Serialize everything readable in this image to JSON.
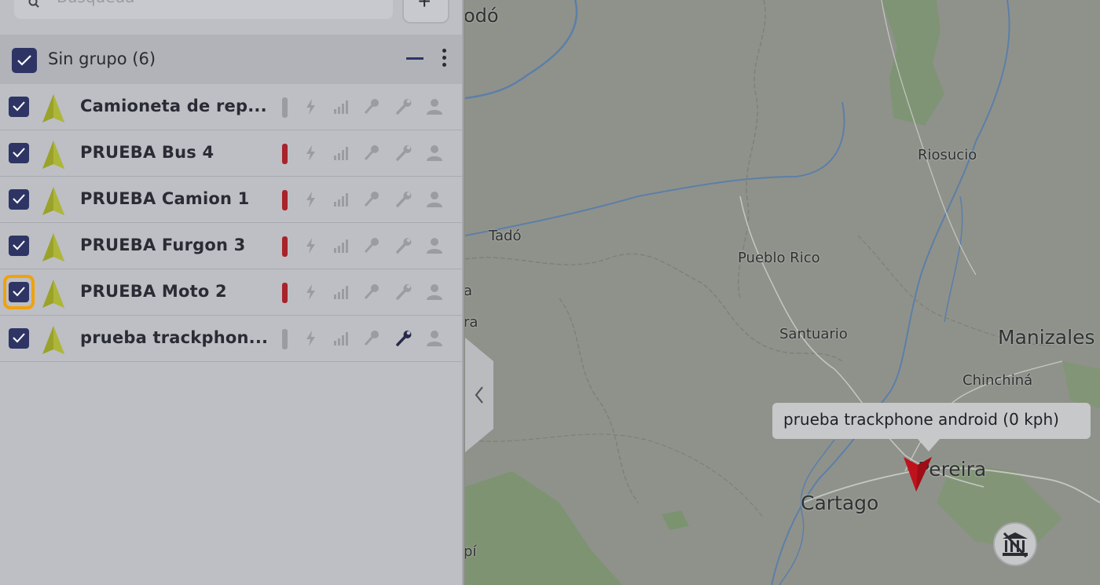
{
  "sidebar": {
    "search": {
      "placeholder": "Búsqueda"
    },
    "add_label": "+",
    "group": {
      "label": "Sin grupo (6)"
    },
    "vehicles": [
      {
        "name": "Camioneta de rep...",
        "status_color": "#9a9ca1",
        "wrench_active": false
      },
      {
        "name": "PRUEBA Bus 4",
        "status_color": "#a8232b",
        "wrench_active": false
      },
      {
        "name": "PRUEBA Camion 1",
        "status_color": "#a8232b",
        "wrench_active": false
      },
      {
        "name": "PRUEBA Furgon 3",
        "status_color": "#a8232b",
        "wrench_active": false
      },
      {
        "name": "PRUEBA Moto 2",
        "status_color": "#a8232b",
        "wrench_active": false
      },
      {
        "name": "prueba trackphon...",
        "status_color": "#9a9ca1",
        "wrench_active": true
      }
    ]
  },
  "map": {
    "places": [
      {
        "label": "odó"
      },
      {
        "label": "Riosucio"
      },
      {
        "label": "Tadó"
      },
      {
        "label": "Pueblo Rico"
      },
      {
        "label": "Santuario"
      },
      {
        "label": "Manizales"
      },
      {
        "label": "Chinchiná"
      },
      {
        "label": "Pereira"
      },
      {
        "label": "Cartago"
      },
      {
        "label": "a"
      },
      {
        "label": "ra"
      },
      {
        "label": "pí"
      }
    ],
    "tooltip": "prueba trackphone android (0 kph)",
    "marker_color": "#c0121c"
  },
  "colors": {
    "accent": "#2e3565",
    "focus": "#f0a20d",
    "alert": "#a8232b"
  }
}
